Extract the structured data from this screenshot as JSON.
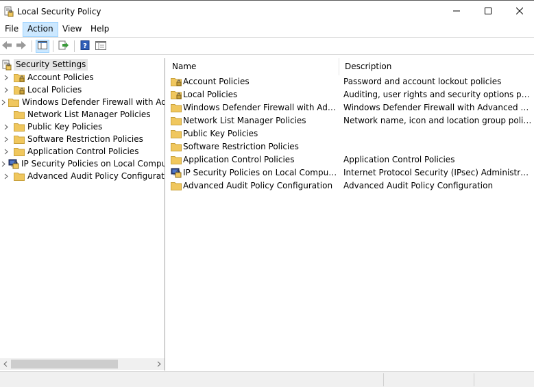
{
  "window": {
    "title": "Local Security Policy",
    "app_icon": "security-policy-icon",
    "buttons": [
      "minimize-icon",
      "maximize-icon",
      "close-icon"
    ]
  },
  "menubar": {
    "items": [
      {
        "label": "File"
      },
      {
        "label": "Action"
      },
      {
        "label": "View"
      },
      {
        "label": "Help"
      }
    ],
    "active": "Action"
  },
  "toolbar": {
    "buttons": [
      "back-icon",
      "forward-icon",
      "show-hide-tree-icon",
      "export-list-icon",
      "help-icon",
      "properties-icon"
    ],
    "pressed": "show-hide-tree-icon"
  },
  "tree": {
    "root": {
      "label": "Security Settings",
      "icon": "security-settings-icon"
    },
    "items": [
      {
        "label": "Account Policies",
        "icon": "locked-folder-icon",
        "expandable": true
      },
      {
        "label": "Local Policies",
        "icon": "locked-folder-icon",
        "expandable": true
      },
      {
        "label": "Windows Defender Firewall with Advanced Security",
        "icon": "folder-icon",
        "expandable": true
      },
      {
        "label": "Network List Manager Policies",
        "icon": "folder-icon",
        "expandable": false
      },
      {
        "label": "Public Key Policies",
        "icon": "folder-icon",
        "expandable": true
      },
      {
        "label": "Software Restriction Policies",
        "icon": "folder-icon",
        "expandable": true
      },
      {
        "label": "Application Control Policies",
        "icon": "folder-icon",
        "expandable": true
      },
      {
        "label": "IP Security Policies on Local Computer",
        "icon": "ipsec-icon",
        "expandable": true
      },
      {
        "label": "Advanced Audit Policy Configuration",
        "icon": "folder-icon",
        "expandable": true
      }
    ]
  },
  "list": {
    "columns": {
      "name": "Name",
      "description": "Description"
    },
    "rows": [
      {
        "name": "Account Policies",
        "description": "Password and account lockout policies",
        "icon": "locked-folder-icon"
      },
      {
        "name": "Local Policies",
        "description": "Auditing, user rights and security options policies",
        "icon": "locked-folder-icon"
      },
      {
        "name": "Windows Defender Firewall with Advanced Security",
        "description": "Windows Defender Firewall with Advanced Security",
        "icon": "folder-icon"
      },
      {
        "name": "Network List Manager Policies",
        "description": "Network name, icon and location group policies.",
        "icon": "folder-icon"
      },
      {
        "name": "Public Key Policies",
        "description": "",
        "icon": "folder-icon"
      },
      {
        "name": "Software Restriction Policies",
        "description": "",
        "icon": "folder-icon"
      },
      {
        "name": "Application Control Policies",
        "description": "Application Control Policies",
        "icon": "folder-icon"
      },
      {
        "name": "IP Security Policies on Local Computer",
        "description": "Internet Protocol Security (IPsec) Administration. Manage IPsec policies for secure communication with other computers.",
        "icon": "ipsec-icon"
      },
      {
        "name": "Advanced Audit Policy Configuration",
        "description": "Advanced Audit Policy Configuration",
        "icon": "folder-icon"
      }
    ]
  },
  "colors": {
    "folder": "#f0c75e",
    "selection": "#cce8ff",
    "tree_root_highlight": "#e5e5e5"
  }
}
